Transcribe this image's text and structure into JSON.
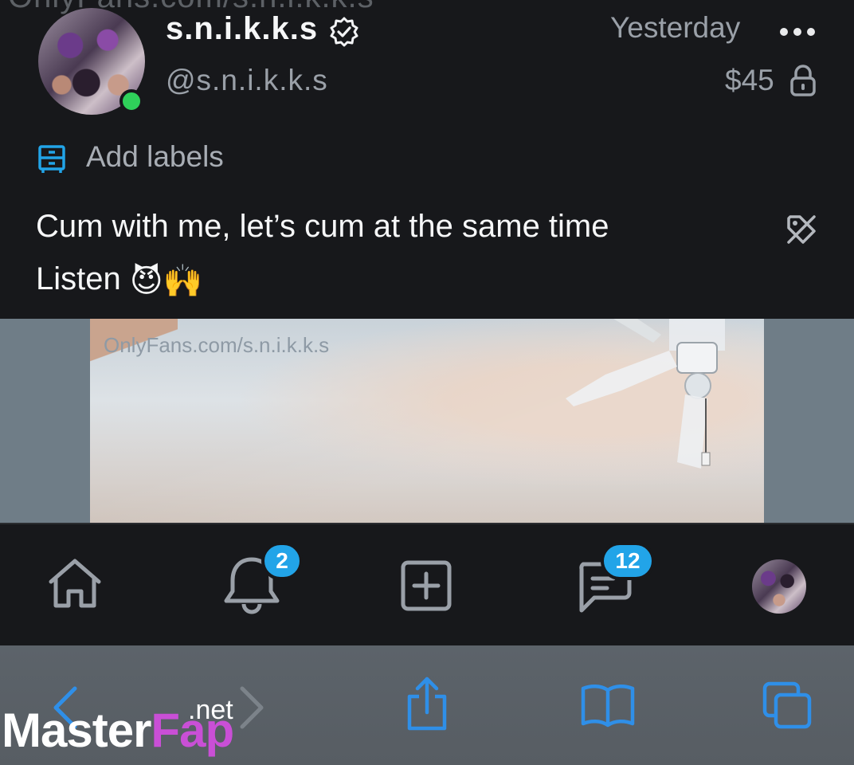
{
  "watermark_top": "OnlyFans.com/s.n.i.k.k.s",
  "post": {
    "display_name": "s.n.i.k.k.s",
    "handle": "@s.n.i.k.k.s",
    "date": "Yesterday",
    "price": "$45",
    "add_labels": "Add labels",
    "caption_line1": "Cum with me, let’s cum at the same time",
    "caption_line2": "Listen",
    "caption_emojis": "😈🙌",
    "media_watermark": "OnlyFans.com/s.n.i.k.k.s"
  },
  "nav": {
    "notifications_badge": "2",
    "messages_badge": "12"
  },
  "branding": {
    "master": "Master",
    "fap": "Fap",
    "net": ".net"
  },
  "colors": {
    "accent": "#22a4e8",
    "online": "#2fd15a",
    "background": "#17181b",
    "browser_icon": "#2f8fe8"
  },
  "icons": [
    "verified-icon",
    "more-icon",
    "lock-icon",
    "label-icon",
    "tag-off-icon",
    "home-icon",
    "bell-icon",
    "add-post-icon",
    "messages-icon",
    "back-icon",
    "forward-icon",
    "share-icon",
    "bookmarks-icon",
    "tabs-icon"
  ]
}
